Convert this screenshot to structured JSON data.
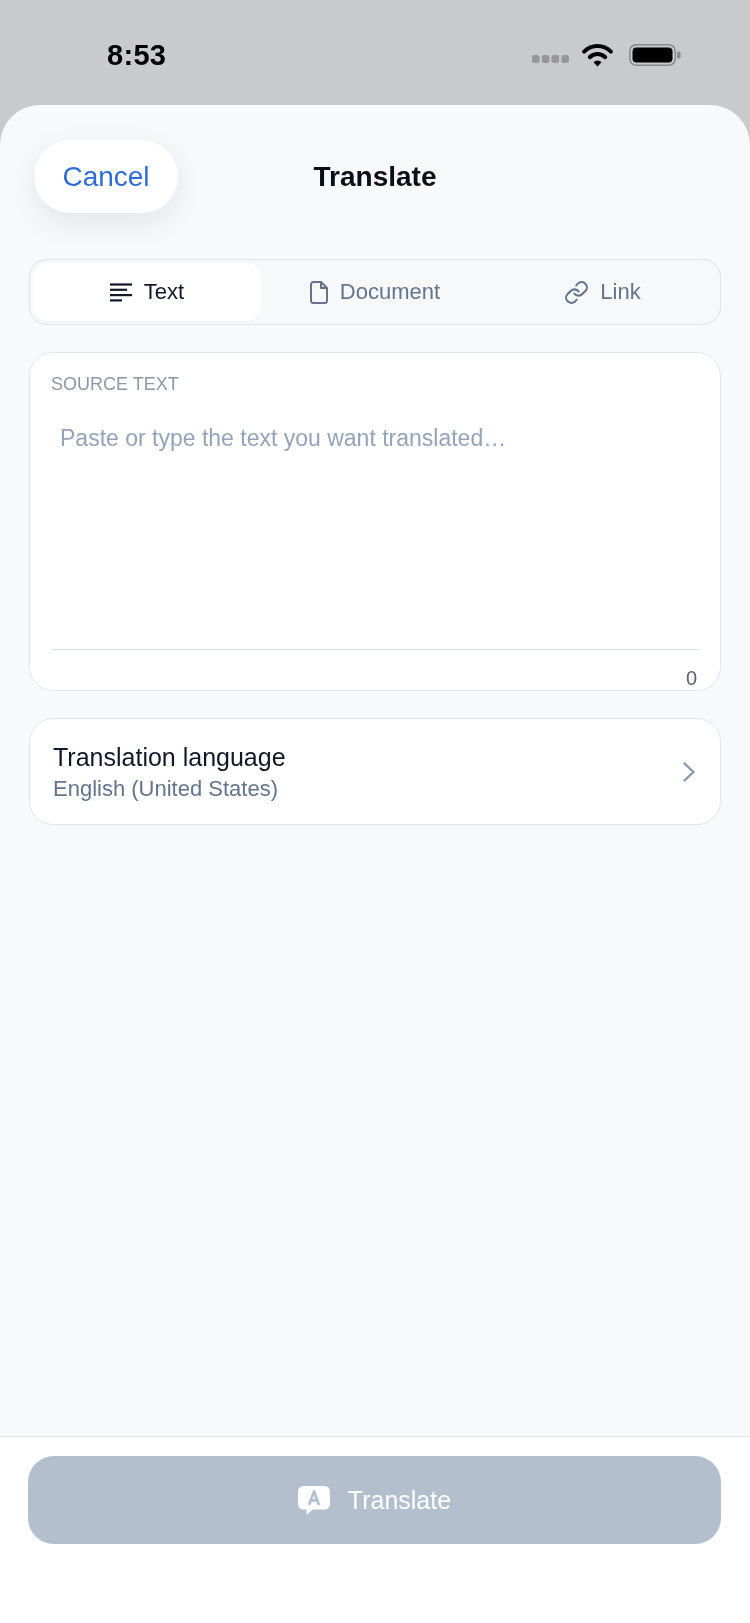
{
  "status_bar": {
    "time": "8:53"
  },
  "header": {
    "cancel_button": "Cancel",
    "title": "Translate"
  },
  "tabs": [
    {
      "label": "Text",
      "kind": "text",
      "selected": true
    },
    {
      "label": "Document",
      "kind": "document",
      "selected": false
    },
    {
      "label": "Link",
      "kind": "link",
      "selected": false
    }
  ],
  "source_text": {
    "label": "SOURCE TEXT",
    "placeholder": "Paste or type the text you want translated…",
    "character_count": "0"
  },
  "translation_language": {
    "label": "Translation language",
    "value": "English (United States)"
  },
  "translate_button": {
    "label": "Translate",
    "disabled": true
  }
}
